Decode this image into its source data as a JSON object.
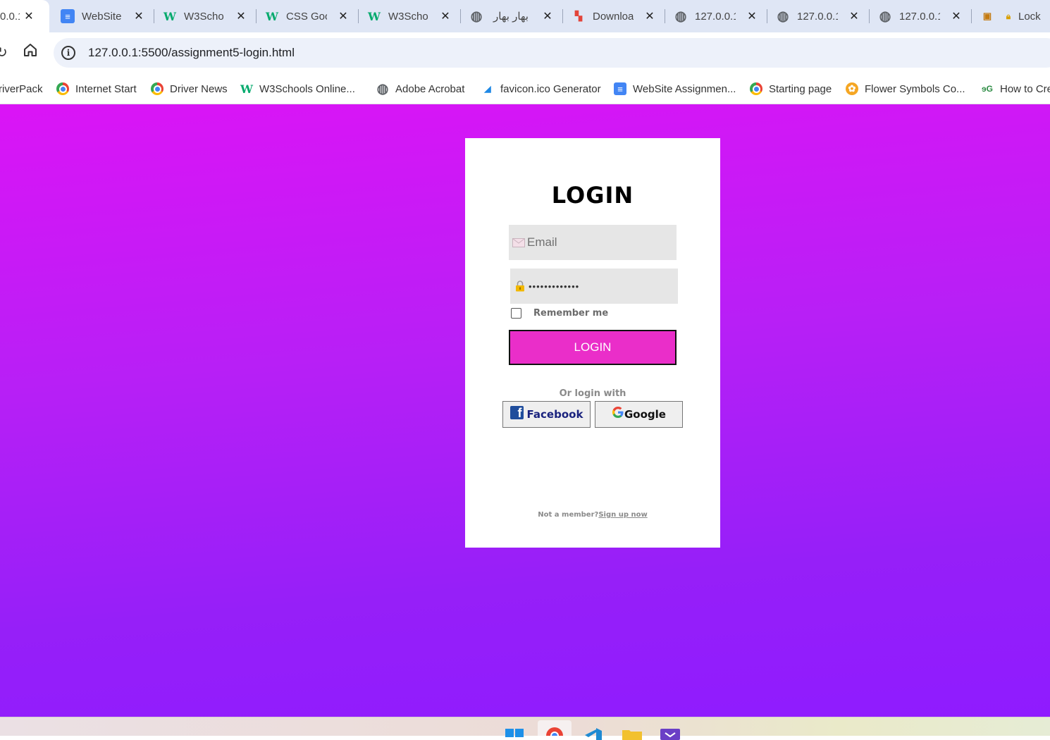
{
  "tabs": [
    {
      "title": "0.0.1",
      "icon": "globe-icon",
      "active": true
    },
    {
      "title": "WebSite",
      "icon": "google-docs-icon"
    },
    {
      "title": "W3Scho",
      "icon": "w3schools-icon"
    },
    {
      "title": "CSS Goo",
      "icon": "w3schools-icon"
    },
    {
      "title": "W3Scho",
      "icon": "w3schools-icon"
    },
    {
      "title": "بهار بهار",
      "icon": "globe-icon"
    },
    {
      "title": "Downloa",
      "icon": "download-site-icon"
    },
    {
      "title": "127.0.0.1",
      "icon": "globe-icon"
    },
    {
      "title": "127.0.0.1",
      "icon": "globe-icon"
    },
    {
      "title": "127.0.0.1",
      "icon": "globe-icon"
    },
    {
      "title": "Lock",
      "icon": "lock-site-icon"
    }
  ],
  "address_bar": {
    "url": "127.0.0.1:5500/assignment5-login.html"
  },
  "bookmarks": [
    {
      "label": "riverPack",
      "icon": "none"
    },
    {
      "label": "Internet Start",
      "icon": "chrome-icon"
    },
    {
      "label": "Driver News",
      "icon": "chrome-icon"
    },
    {
      "label": "W3Schools Online...",
      "icon": "w3schools-icon"
    },
    {
      "label": "Adobe Acrobat",
      "icon": "globe-icon"
    },
    {
      "label": "favicon.ico Generator",
      "icon": "favicon-generator-icon"
    },
    {
      "label": "WebSite Assignmen...",
      "icon": "google-docs-icon"
    },
    {
      "label": "Starting page",
      "icon": "chrome-icon"
    },
    {
      "label": "Flower Symbols Co...",
      "icon": "flower-icon"
    },
    {
      "label": "How to Cre",
      "icon": "geeksforgeeks-icon"
    }
  ],
  "login": {
    "title": "LOGIN",
    "email_placeholder": "Email",
    "password_value": "•••••••••••••",
    "remember_label": "Remember me",
    "remember_checked": false,
    "button_label": "LOGIN",
    "or_text": "Or login with",
    "facebook_label": "Facebook",
    "google_label": "Google",
    "not_member_text": "Not a member?",
    "signup_link": "Sign up now"
  },
  "colors": {
    "background_top": "#db14f6",
    "background_bottom": "#8f1bff",
    "login_button": "#ea2ec9",
    "card": "#ffffff",
    "field": "#e6e6e6"
  }
}
